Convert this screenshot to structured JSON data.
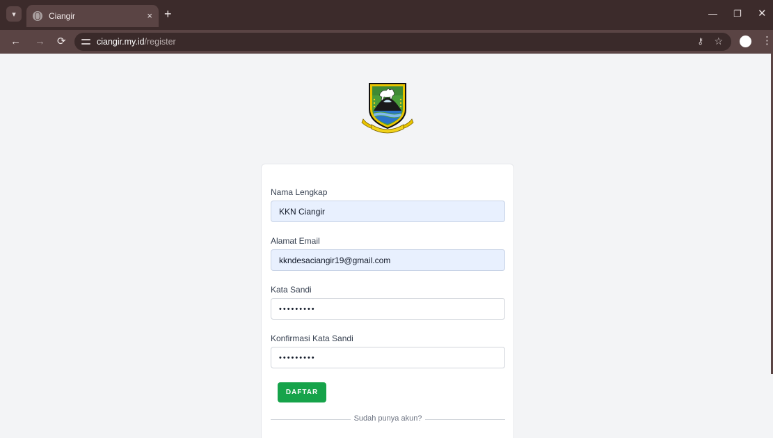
{
  "browser": {
    "tab_title": "Ciangir",
    "tab_close": "×",
    "new_tab": "+",
    "url_domain": "ciangir.my.id",
    "url_path": "/register",
    "window_min": "—",
    "window_max": "❐",
    "window_close": "✕"
  },
  "form": {
    "name_label": "Nama Lengkap",
    "name_value": "KKN Ciangir",
    "email_label": "Alamat Email",
    "email_value": "kkndesaciangir19@gmail.com",
    "password_label": "Kata Sandi",
    "password_value": "kkn123456",
    "confirm_label": "Konfirmasi Kata Sandi",
    "confirm_value": "kkn123456",
    "submit_label": "DAFTAR",
    "divider_text": "Sudah punya akun?"
  },
  "colors": {
    "chrome_dark": "#3c2b2b",
    "chrome_toolbar": "#5a4444",
    "submit_green": "#16a34a",
    "autofill_blue": "#e8f0fe"
  },
  "icons": {
    "tab_favicon": "globe-icon",
    "logo": "regency-emblem"
  }
}
